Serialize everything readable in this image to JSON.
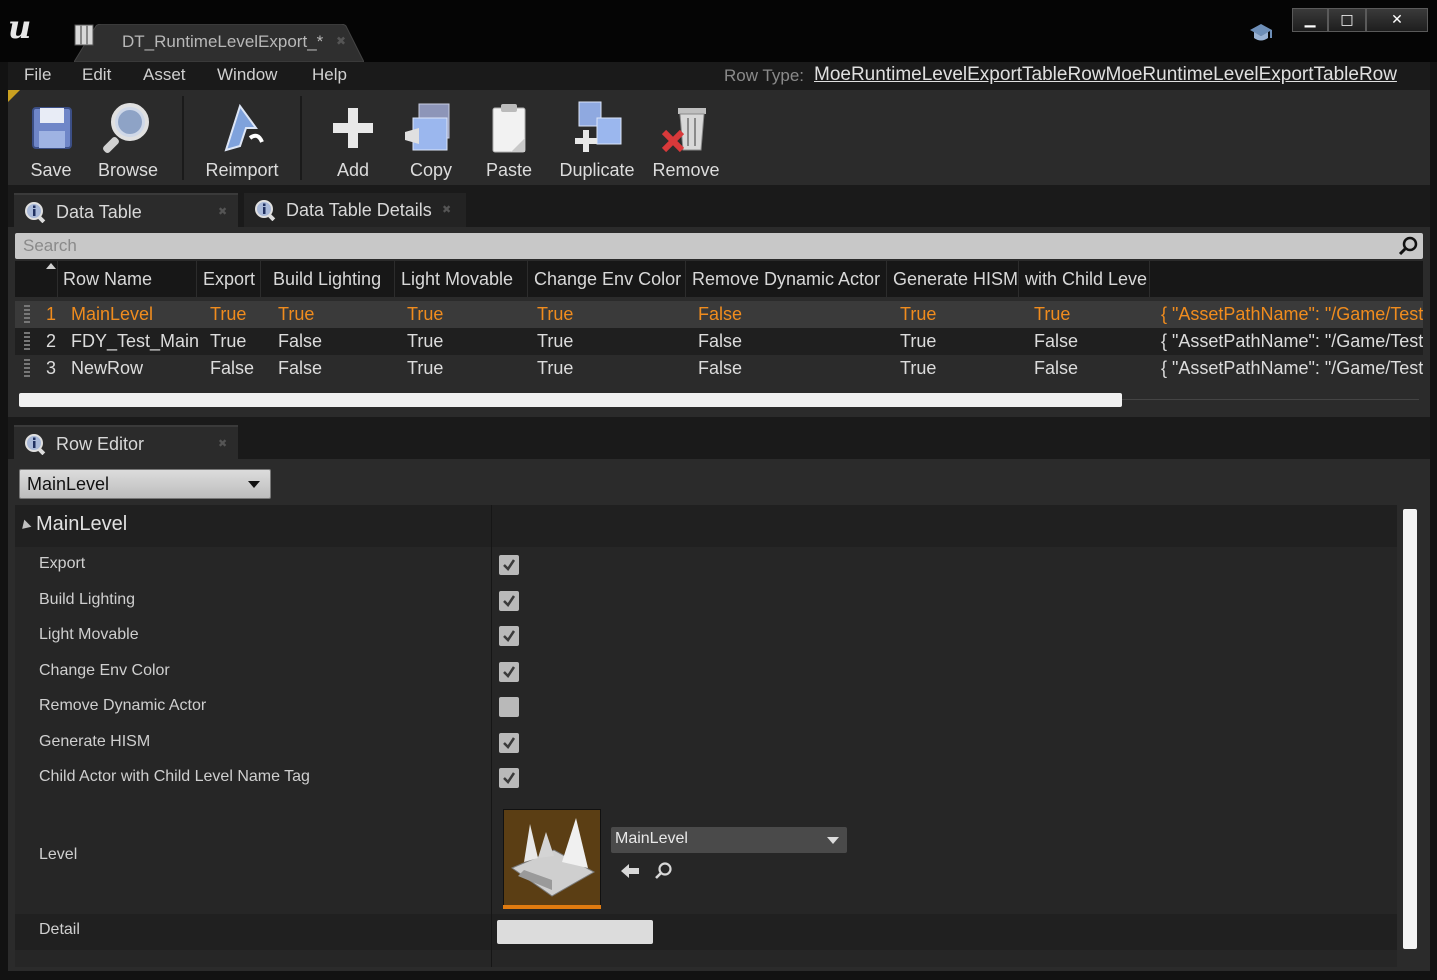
{
  "window": {
    "tab_title": "DT_RuntimeLevelExport_*",
    "min_glyph": "▁",
    "max_glyph": "□",
    "close_glyph": "✕"
  },
  "menu": {
    "items": [
      "File",
      "Edit",
      "Asset",
      "Window",
      "Help"
    ],
    "row_type_label": "Row Type:",
    "row_type_value": "MoeRuntimeLevelExportTableRowMoeRuntimeLevelExportTableRow"
  },
  "toolbar": {
    "save": "Save",
    "browse": "Browse",
    "reimport": "Reimport",
    "add": "Add",
    "copy": "Copy",
    "paste": "Paste",
    "duplicate": "Duplicate",
    "remove": "Remove"
  },
  "tabs": {
    "data_table": "Data Table",
    "data_table_details": "Data Table Details",
    "row_editor": "Row Editor"
  },
  "search": {
    "placeholder": "Search"
  },
  "table": {
    "columns": [
      "Row Name",
      "Export",
      "Build Lighting",
      "Light Movable",
      "Change Env Color",
      "Remove Dynamic Actor",
      "Generate HISM",
      "with Child Leve"
    ],
    "rows": [
      {
        "num": "1",
        "name": "MainLevel",
        "export": "True",
        "build_lighting": "True",
        "light_movable": "True",
        "change_env_color": "True",
        "remove_dynamic_actor": "False",
        "generate_hism": "True",
        "child": "True",
        "level": "{ \"AssetPathName\": \"/Game/Test"
      },
      {
        "num": "2",
        "name": "FDY_Test_Main",
        "export": "True",
        "build_lighting": "False",
        "light_movable": "True",
        "change_env_color": "True",
        "remove_dynamic_actor": "False",
        "generate_hism": "True",
        "child": "False",
        "level": "{ \"AssetPathName\": \"/Game/Test"
      },
      {
        "num": "3",
        "name": "NewRow",
        "export": "False",
        "build_lighting": "False",
        "light_movable": "True",
        "change_env_color": "True",
        "remove_dynamic_actor": "False",
        "generate_hism": "True",
        "child": "False",
        "level": "{ \"AssetPathName\": \"/Game/Test"
      }
    ],
    "selected_row_color": "#f08c1e"
  },
  "row_editor": {
    "selected_row": "MainLevel",
    "category": "MainLevel",
    "properties": [
      {
        "label": "Export",
        "checked": true
      },
      {
        "label": "Build Lighting",
        "checked": true
      },
      {
        "label": "Light Movable",
        "checked": true
      },
      {
        "label": "Change Env Color",
        "checked": true
      },
      {
        "label": "Remove Dynamic Actor",
        "checked": false
      },
      {
        "label": "Generate HISM",
        "checked": true
      },
      {
        "label": "Child Actor with Child Level Name Tag",
        "checked": true
      }
    ],
    "level_label": "Level",
    "level_value": "MainLevel",
    "detail_label": "Detail"
  },
  "icons": [
    "ue-logo",
    "map-icon",
    "graduation-cap-icon",
    "save-icon",
    "browse-icon",
    "reimport-icon",
    "add-icon",
    "copy-icon",
    "paste-icon",
    "duplicate-icon",
    "remove-icon",
    "info-icon",
    "search-icon",
    "use-selected-arrow-icon",
    "browse-magnifier-icon"
  ]
}
